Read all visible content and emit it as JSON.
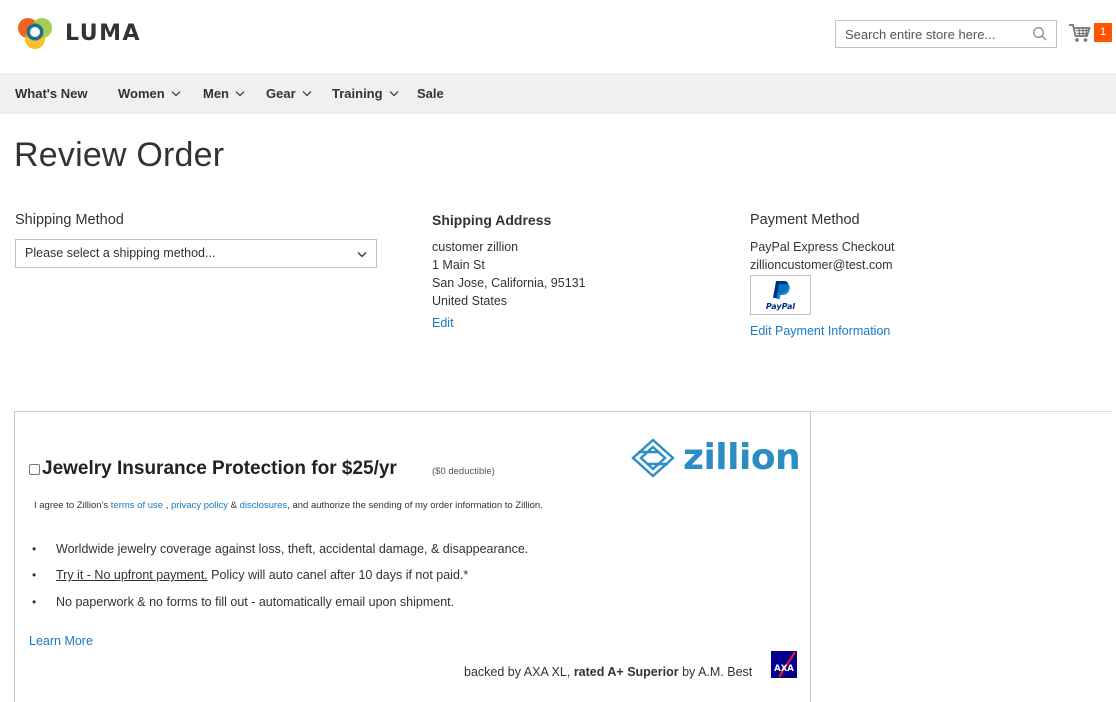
{
  "brand": {
    "name": "LUMA",
    "accent_orange": "#f26322",
    "link_color": "#1979c3"
  },
  "search": {
    "placeholder": "Search entire store here..."
  },
  "cart": {
    "count": "1"
  },
  "nav": {
    "items": [
      {
        "label": "What's New",
        "has_menu": false
      },
      {
        "label": "Women",
        "has_menu": true
      },
      {
        "label": "Men",
        "has_menu": true
      },
      {
        "label": "Gear",
        "has_menu": true
      },
      {
        "label": "Training",
        "has_menu": true
      },
      {
        "label": "Sale",
        "has_menu": false
      }
    ]
  },
  "page": {
    "title": "Review Order"
  },
  "shipping_method": {
    "title": "Shipping Method",
    "selected": "Please select a shipping method..."
  },
  "shipping_address": {
    "title": "Shipping Address",
    "lines": [
      "customer zillion",
      "1 Main St",
      "San Jose, California, 95131",
      "United States"
    ],
    "edit_label": "Edit"
  },
  "payment_method": {
    "title": "Payment Method",
    "method": "PayPal Express Checkout",
    "email": "zillioncustomer@test.com",
    "paypal_logo_text": "PayPal",
    "edit_label": "Edit Payment Information"
  },
  "zillion": {
    "logo_text": "zillion",
    "title": "Jewelry Insurance Protection for $25/yr",
    "deductible": "($0 deductible)",
    "agree_prefix": "I agree to Zillion's",
    "terms_label": "terms of use",
    "sep1": ",",
    "privacy_label": "privacy policy",
    "sep2": "&",
    "disclosures_label": "disclosures",
    "agree_suffix": ", and authorize the sending of my order information to Zillion.",
    "bullets": [
      {
        "underline": "",
        "text": "Worldwide jewelry coverage against loss, theft, accidental damage, & disappearance."
      },
      {
        "underline": "Try it - No upfront payment.",
        "text": " Policy will auto canel after 10 days if not paid.*"
      },
      {
        "underline": "",
        "text": "No paperwork & no forms to fill out - automatically email upon shipment."
      }
    ],
    "learn_more": "Learn More",
    "backed_prefix": "backed by AXA XL,",
    "backed_bold": "rated A+ Superior",
    "backed_suffix": "by A.M. Best",
    "axa_logo_text": "AXA"
  }
}
